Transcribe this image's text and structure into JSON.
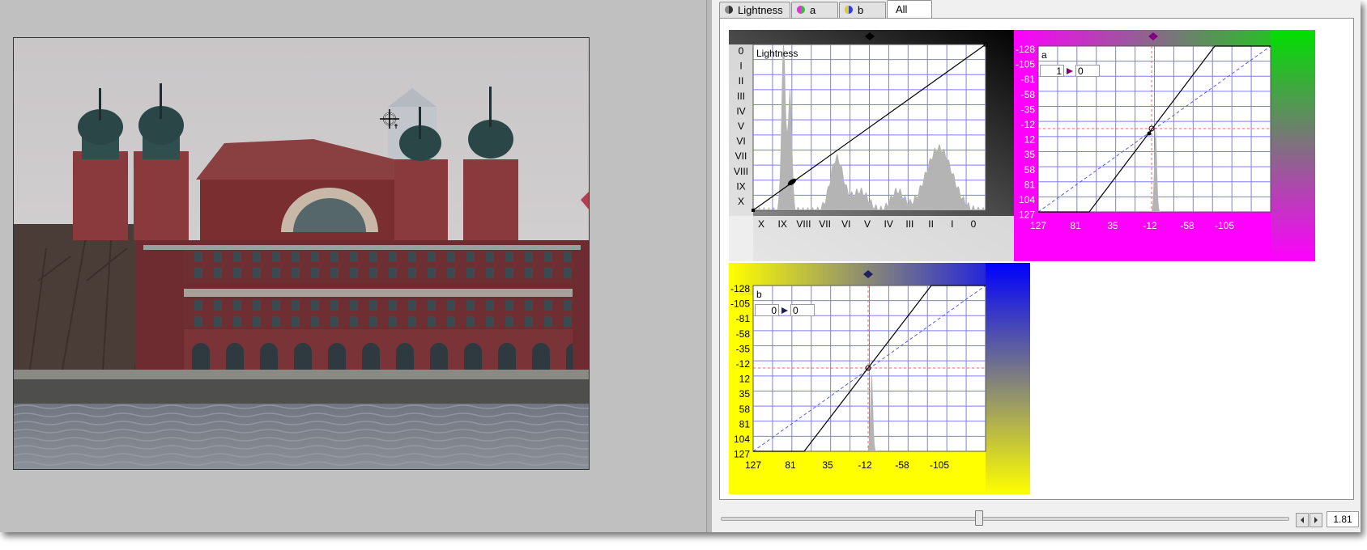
{
  "tabs": [
    {
      "label": "Lightness",
      "icon": "lightness-channel-icon",
      "active": false
    },
    {
      "label": "a",
      "icon": "a-channel-icon",
      "active": false
    },
    {
      "label": "b",
      "icon": "b-channel-icon",
      "active": false
    },
    {
      "label": "All",
      "active": true
    }
  ],
  "lightness": {
    "label": "Lightness",
    "zones_vertical": [
      "0",
      "I",
      "II",
      "III",
      "IV",
      "V",
      "VI",
      "VII",
      "VIII",
      "IX",
      "X"
    ],
    "zones_horizontal": [
      "X",
      "IX",
      "VIII",
      "VII",
      "VI",
      "V",
      "IV",
      "III",
      "II",
      "I",
      "0"
    ]
  },
  "a": {
    "label": "a",
    "input_value": "1",
    "output_value": "0",
    "y_ticks": [
      "-128",
      "-105",
      "-81",
      "-58",
      "-35",
      "-12",
      "12",
      "35",
      "58",
      "81",
      "104",
      "127"
    ],
    "x_ticks": [
      "127",
      "81",
      "35",
      "-12",
      "-58",
      "-105"
    ]
  },
  "b": {
    "label": "b",
    "input_value": "0",
    "output_value": "0",
    "y_ticks": [
      "-128",
      "-105",
      "-81",
      "-58",
      "-35",
      "-12",
      "12",
      "35",
      "58",
      "81",
      "104",
      "127"
    ],
    "x_ticks": [
      "127",
      "81",
      "35",
      "-12",
      "-58",
      "-105"
    ]
  },
  "zoom": {
    "value": "1.81"
  },
  "colors": {
    "a_neg": "#ff00ff",
    "a_pos": "#00e000",
    "b_neg": "#ffff00",
    "b_pos": "#0000ff",
    "grid": "#7d7df2",
    "histogram": "#b4b4b4"
  }
}
